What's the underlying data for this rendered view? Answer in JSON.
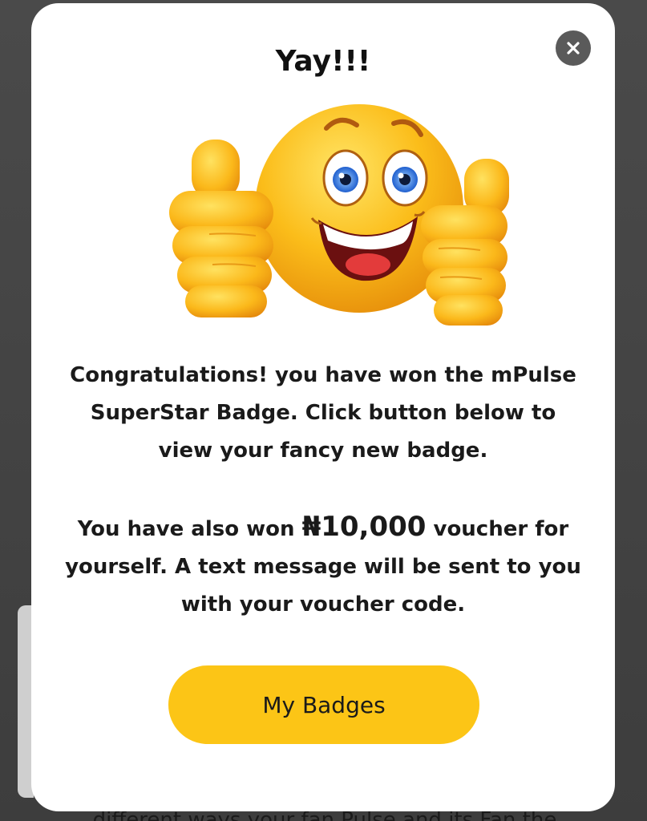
{
  "dialog": {
    "title": "Yay!!!",
    "message_1": "Congratulations! you have won the mPulse SuperStar Badge. Click button below to view your fancy new badge.",
    "message_2_prefix": "You have also won ",
    "voucher_amount": "₦10,000",
    "message_2_suffix": " voucher for yourself. A text message will be sent to you with your voucher code.",
    "button_label": "My Badges",
    "close_icon": "close-icon",
    "emoji_icon": "thumbs-up-smiley-icon"
  },
  "background": {
    "partial_text": "different ways your fan Pulse and its Fan the"
  },
  "colors": {
    "button": "#fcc516",
    "close_button": "#5a5a5a",
    "emoji_face": "#f9b718"
  }
}
